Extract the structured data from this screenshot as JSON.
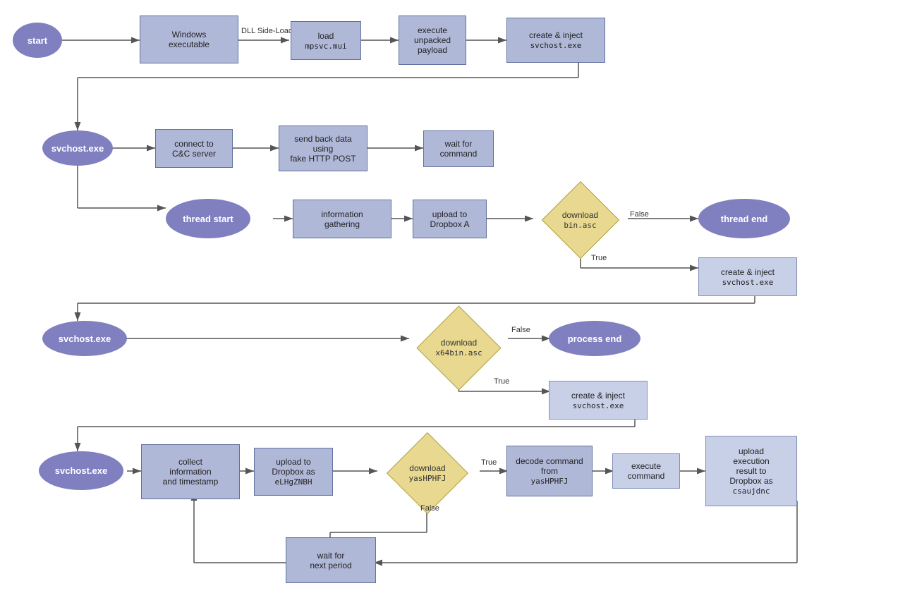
{
  "nodes": {
    "start": {
      "label": "start"
    },
    "win_exec": {
      "label": "Windows\nexecutable"
    },
    "load_mpsvc": {
      "label": "load\nmpsvc.mui"
    },
    "execute_payload": {
      "label": "execute\nunpacked\npayload"
    },
    "create_inject_1": {
      "label": "create & inject\nsvchost.exe"
    },
    "svchost1": {
      "label": "svchost.exe"
    },
    "connect_cc": {
      "label": "connect to\nC&C server"
    },
    "send_back": {
      "label": "send back data\nusing\nfake HTTP POST"
    },
    "wait_command": {
      "label": "wait for\ncommand"
    },
    "thread_start": {
      "label": "thread start"
    },
    "info_gathering": {
      "label": "information\ngathering"
    },
    "upload_dropbox_a": {
      "label": "upload to\nDropbox A"
    },
    "download_binasc": {
      "label": "download\nbin.asc"
    },
    "thread_end": {
      "label": "thread end"
    },
    "create_inject_2": {
      "label": "create & inject\nsvchost.exe"
    },
    "svchost2": {
      "label": "svchost.exe"
    },
    "download_x64": {
      "label": "download\nx64bin.asc"
    },
    "process_end": {
      "label": "process end"
    },
    "create_inject_3": {
      "label": "create & inject\nsvchost.exe"
    },
    "svchost3": {
      "label": "svchost.exe"
    },
    "collect_info": {
      "label": "collect\ninformation\nand timestamp"
    },
    "upload_eLHg": {
      "label": "upload to\nDropbox as\neLHgZNBH"
    },
    "download_yas": {
      "label": "download\nyasHPHFJ"
    },
    "decode_cmd": {
      "label": "decode command\nfrom\nyasHPHFJ"
    },
    "execute_cmd": {
      "label": "execute\ncommand"
    },
    "upload_result": {
      "label": "upload\nexecution\nresult to\nDropbox as\ncsaujdnc"
    },
    "wait_next": {
      "label": "wait for\nnext period"
    }
  },
  "labels": {
    "dll_side": "DLL Side-Loading",
    "false": "False",
    "true": "True"
  }
}
